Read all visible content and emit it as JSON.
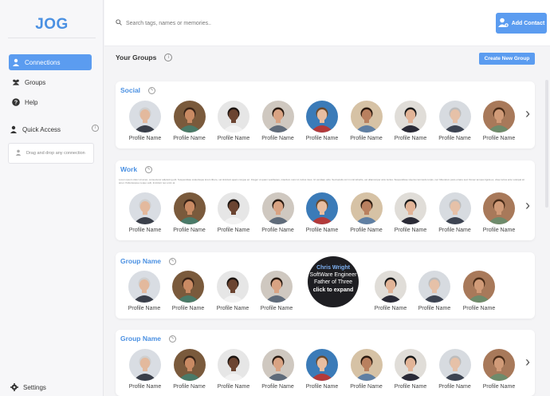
{
  "app": {
    "logo": "JOG"
  },
  "sidebar": {
    "items": [
      {
        "label": "Connections",
        "active": true
      },
      {
        "label": "Groups",
        "active": false
      },
      {
        "label": "Help",
        "active": false
      }
    ],
    "quick_access": {
      "label": "Quick Access",
      "dropzone": "Drag and drop any connection"
    },
    "settings_label": "Settings"
  },
  "header": {
    "search_placeholder": "Search tags, names or memories..",
    "add_contact_label": "Add Contact"
  },
  "main": {
    "title": "Your Groups",
    "create_button": "Create New Group",
    "groups": [
      {
        "title": "Social",
        "description": "",
        "profiles": [
          "Profile Name",
          "Profile Name",
          "Profile Name",
          "Profile Name",
          "Profile Name",
          "Profile Name",
          "Profile Name",
          "Profile Name",
          "Profile Name"
        ]
      },
      {
        "title": "Work",
        "description": "Lorem ipsum dolor sit amet, consectetur adipiscing elit. Suspendisse scelerisque lorem libero, vel tincidunt quam congue ac. Integer ut quam vestibulum, interdum nunc id, luctus risus. Ut vel diam odio. Sed iaculis orci in nisl lobortis, vel ullamcorper arcu luctus. Suspendisse viverra commodo turpis, nec bibendum justo ornare sed. Donec tempus ligula ex, vitae luctus ante volutpat sit amet. Pellentesque neque velit, tincidunt nec enim at.",
        "profiles": [
          "Profile Name",
          "Profile Name",
          "Profile Name",
          "Profile Name",
          "Profile Name",
          "Profile Name",
          "Profile Name",
          "Profile Name",
          "Profile Name"
        ]
      },
      {
        "title": "Group Name",
        "description": "",
        "profiles": [
          "Profile Name",
          "Profile Name",
          "Profile Name",
          "Profile Name",
          "Profile Name",
          "Profile Name",
          "Profile Name",
          "Profile Name"
        ],
        "hover_card": {
          "name": "Chris Wright",
          "line1": "SoftWare Engineer",
          "line2": "Father of Three",
          "cta": "click to expand"
        }
      },
      {
        "title": "Group Name",
        "description": "",
        "profiles": [
          "Profile Name",
          "Profile Name",
          "Profile Name",
          "Profile Name",
          "Profile Name",
          "Profile Name",
          "Profile Name",
          "Profile Name",
          "Profile Name"
        ]
      }
    ]
  },
  "colors": {
    "accent": "#5b9cf0",
    "brand": "#4a90e2"
  },
  "icons": [
    "user-icon",
    "users-icon",
    "help-icon",
    "quick-access-icon",
    "info-icon",
    "drag-icon",
    "settings-icon",
    "search-icon",
    "add-contact-icon",
    "edit-icon",
    "chevron-right-icon"
  ]
}
